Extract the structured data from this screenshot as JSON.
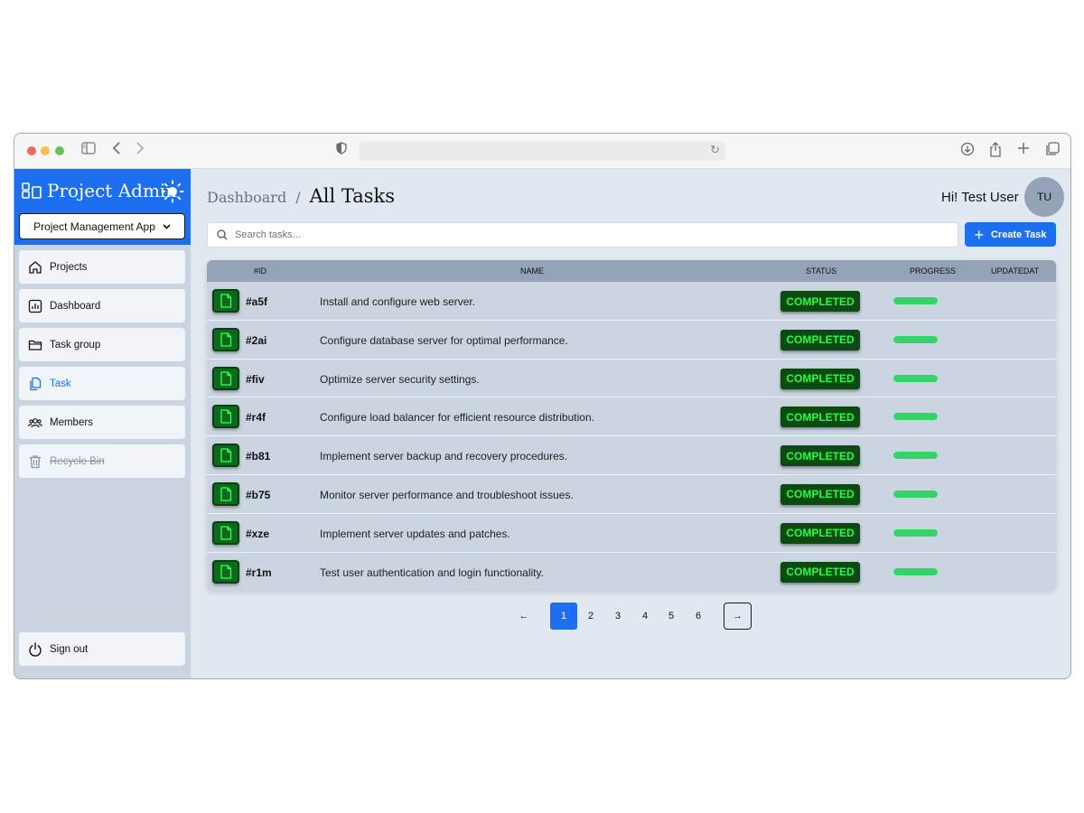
{
  "sidebar": {
    "brand": "Project Admin",
    "app_select": "Project Management App",
    "items": [
      {
        "label": "Projects",
        "icon": "home-icon"
      },
      {
        "label": "Dashboard",
        "icon": "chart-icon"
      },
      {
        "label": "Task group",
        "icon": "folder-icon"
      },
      {
        "label": "Task",
        "icon": "copy-icon",
        "active": true
      },
      {
        "label": "Members",
        "icon": "users-icon"
      },
      {
        "label": "Recycle Bin",
        "icon": "trash-icon",
        "disabled": true
      }
    ],
    "signout": "Sign out"
  },
  "header": {
    "breadcrumb_root": "Dashboard",
    "breadcrumb_sep": "/",
    "title": "All Tasks",
    "greeting": "Hi! Test User",
    "avatar_initials": "TU"
  },
  "search": {
    "placeholder": "Search tasks..."
  },
  "create_button": "Create Task",
  "table": {
    "columns": [
      "#ID",
      "NAME",
      "STATUS",
      "PROGRESS",
      "UPDATEDAT"
    ],
    "rows": [
      {
        "id": "#a5f",
        "name": "Install and configure web server.",
        "status": "COMPLETED",
        "progress": 1.0
      },
      {
        "id": "#2ai",
        "name": "Configure database server for optimal performance.",
        "status": "COMPLETED",
        "progress": 1.0
      },
      {
        "id": "#fiv",
        "name": "Optimize server security settings.",
        "status": "COMPLETED",
        "progress": 1.0
      },
      {
        "id": "#r4f",
        "name": "Configure load balancer for efficient resource distribution.",
        "status": "COMPLETED",
        "progress": 1.0
      },
      {
        "id": "#b81",
        "name": "Implement server backup and recovery procedures.",
        "status": "COMPLETED",
        "progress": 1.0
      },
      {
        "id": "#b75",
        "name": "Monitor server performance and troubleshoot issues.",
        "status": "COMPLETED",
        "progress": 1.0
      },
      {
        "id": "#xze",
        "name": "Implement server updates and patches.",
        "status": "COMPLETED",
        "progress": 1.0
      },
      {
        "id": "#r1m",
        "name": "Test user authentication and login functionality.",
        "status": "COMPLETED",
        "progress": 1.0
      }
    ]
  },
  "pagination": {
    "prev": "←",
    "pages": [
      "1",
      "2",
      "3",
      "4",
      "5",
      "6"
    ],
    "current": "1",
    "next": "→"
  },
  "colors": {
    "accent": "#1e6ff0",
    "status_bg": "#0b4a12",
    "status_text": "#22ff44",
    "progress_fill": "#34d46a"
  }
}
